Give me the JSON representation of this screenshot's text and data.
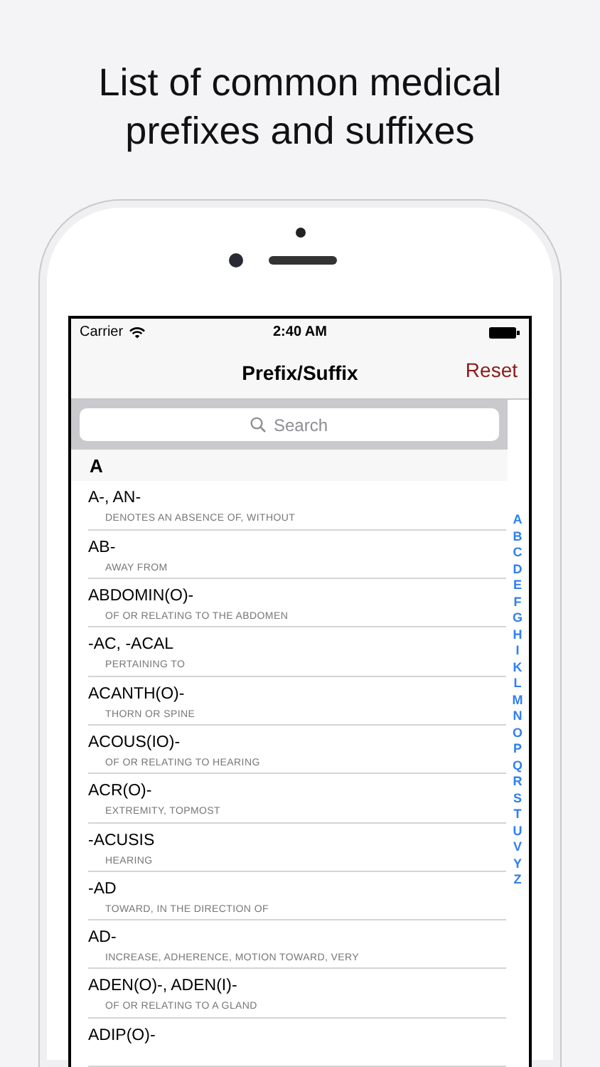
{
  "headline": "List of common medical prefixes and suffixes",
  "status_bar": {
    "carrier": "Carrier",
    "time": "2:40 AM"
  },
  "nav": {
    "title": "Prefix/Suffix",
    "reset": "Reset"
  },
  "search": {
    "placeholder": "Search"
  },
  "sections": [
    {
      "letter": "A",
      "entries": [
        {
          "term": "A-, AN-",
          "meaning": "DENOTES AN ABSENCE OF, WITHOUT"
        },
        {
          "term": "AB-",
          "meaning": "AWAY FROM"
        },
        {
          "term": "ABDOMIN(O)-",
          "meaning": "OF OR RELATING TO THE ABDOMEN"
        },
        {
          "term": "-AC, -ACAL",
          "meaning": "PERTAINING TO"
        },
        {
          "term": "ACANTH(O)-",
          "meaning": "THORN OR SPINE"
        },
        {
          "term": "ACOUS(IO)-",
          "meaning": "OF OR RELATING TO HEARING"
        },
        {
          "term": "ACR(O)-",
          "meaning": "EXTREMITY, TOPMOST"
        },
        {
          "term": "-ACUSIS",
          "meaning": "HEARING"
        },
        {
          "term": "-AD",
          "meaning": "TOWARD, IN THE DIRECTION OF"
        },
        {
          "term": "AD-",
          "meaning": "INCREASE, ADHERENCE, MOTION TOWARD, VERY"
        },
        {
          "term": "ADEN(O)-, ADEN(I)-",
          "meaning": "OF OR RELATING TO A GLAND"
        },
        {
          "term": "ADIP(O)-"
        }
      ]
    }
  ],
  "index": [
    "A",
    "B",
    "C",
    "D",
    "E",
    "F",
    "G",
    "H",
    "I",
    "K",
    "L",
    "M",
    "N",
    "O",
    "P",
    "Q",
    "R",
    "S",
    "T",
    "U",
    "V",
    "Y",
    "Z"
  ]
}
